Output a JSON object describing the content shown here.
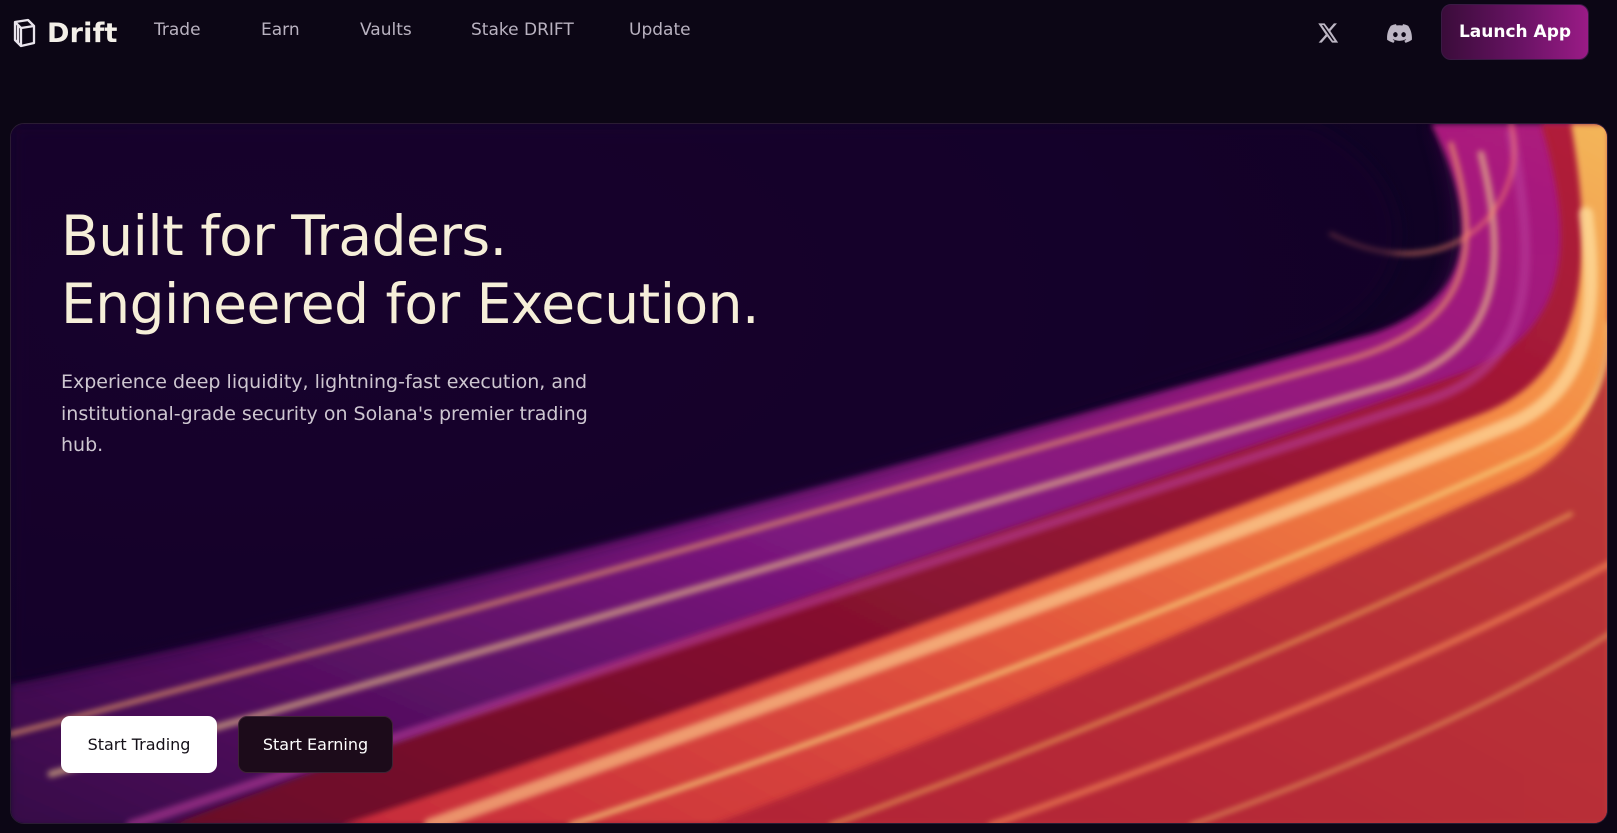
{
  "brand": {
    "name": "Drift",
    "logo_icon": "drift-logo-icon"
  },
  "nav": {
    "links": [
      {
        "label": "Trade"
      },
      {
        "label": "Earn"
      },
      {
        "label": "Vaults"
      },
      {
        "label": "Stake DRIFT"
      },
      {
        "label": "Update"
      }
    ],
    "social": [
      {
        "icon": "x-twitter-icon"
      },
      {
        "icon": "discord-icon"
      }
    ],
    "cta_label": "Launch App"
  },
  "hero": {
    "headline_line1": "Built for Traders.",
    "headline_line2": "Engineered for Execution.",
    "subtext": "Experience deep liquidity, lightning-fast execution, and institutional-grade security on Solana's premier trading hub.",
    "primary_button": "Start Trading",
    "secondary_button": "Start Earning"
  },
  "colors": {
    "page_background": "#0c0615",
    "hero_background": "#12042a",
    "headline_text": "#f6efd9",
    "launch_gradient_start": "#3a0c3a",
    "launch_gradient_end": "#9a1b86",
    "streak_orange": "#f07a3a",
    "streak_magenta": "#a01a8a",
    "streak_yellow": "#f3d25a"
  }
}
